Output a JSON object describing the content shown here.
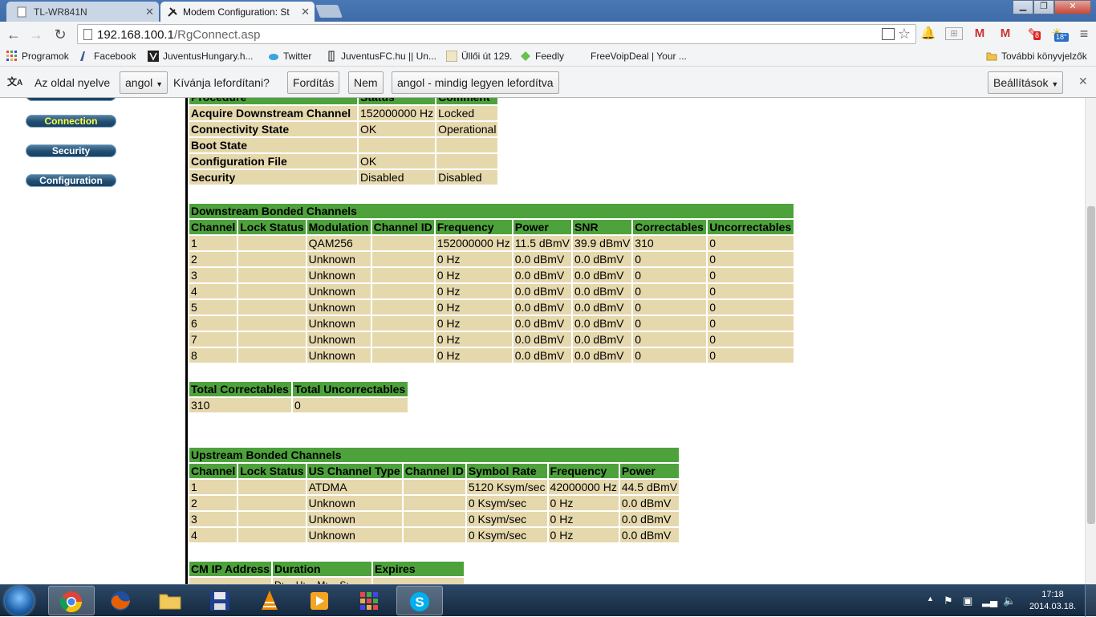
{
  "tabs": [
    {
      "title": "TL-WR841N",
      "active": false
    },
    {
      "title": "Modem Configuration: St",
      "active": true
    }
  ],
  "omnibox": {
    "host": "192.168.100.1",
    "path": "/RgConnect.asp"
  },
  "bookmarks": [
    {
      "label": "Programok",
      "icon": "apps-grid-icon"
    },
    {
      "label": "Facebook",
      "icon": "facebook-icon"
    },
    {
      "label": "JuventusHungary.h...",
      "icon": "juventus-hungary-icon"
    },
    {
      "label": "Twitter",
      "icon": "twitter-bird-icon"
    },
    {
      "label": "JuventusFC.hu || Un...",
      "icon": "juventus-crest-icon"
    },
    {
      "label": "Üllői út 129.",
      "icon": "ulloi-icon"
    },
    {
      "label": "Feedly",
      "icon": "feedly-icon"
    },
    {
      "label": "FreeVoipDeal | Your ...",
      "icon": ""
    },
    {
      "label": "További könyvjelzők",
      "icon": "folder-icon"
    }
  ],
  "translate": {
    "prompt_1": "Az oldal nyelve",
    "language": "angol",
    "prompt_2": "Kívánja lefordítani?",
    "translate_btn": "Fordítás",
    "no_btn": "Nem",
    "always_btn": "angol - mindig legyen lefordítva",
    "settings_btn": "Beállítások"
  },
  "sidebar": {
    "items": [
      {
        "label": "Connection",
        "active": true
      },
      {
        "label": "Security",
        "active": false
      },
      {
        "label": "Configuration",
        "active": false
      }
    ]
  },
  "startup": {
    "headers": [
      "Procedure",
      "Status",
      "Comment"
    ],
    "rows": [
      [
        "Acquire Downstream Channel",
        "152000000 Hz",
        "Locked"
      ],
      [
        "Connectivity State",
        "OK",
        "Operational"
      ],
      [
        "Boot State",
        "",
        ""
      ],
      [
        "Configuration File",
        "OK",
        ""
      ],
      [
        "Security",
        "Disabled",
        "Disabled"
      ]
    ]
  },
  "downstream": {
    "title": "Downstream Bonded Channels",
    "headers": [
      "Channel",
      "Lock Status",
      "Modulation",
      "Channel ID",
      "Frequency",
      "Power",
      "SNR",
      "Correctables",
      "Uncorrectables"
    ],
    "rows": [
      [
        "1",
        "",
        "QAM256",
        "",
        "152000000 Hz",
        "11.5 dBmV",
        "39.9 dBmV",
        "310",
        "0"
      ],
      [
        "2",
        "",
        "Unknown",
        "",
        "0 Hz",
        "0.0 dBmV",
        "0.0 dBmV",
        "0",
        "0"
      ],
      [
        "3",
        "",
        "Unknown",
        "",
        "0 Hz",
        "0.0 dBmV",
        "0.0 dBmV",
        "0",
        "0"
      ],
      [
        "4",
        "",
        "Unknown",
        "",
        "0 Hz",
        "0.0 dBmV",
        "0.0 dBmV",
        "0",
        "0"
      ],
      [
        "5",
        "",
        "Unknown",
        "",
        "0 Hz",
        "0.0 dBmV",
        "0.0 dBmV",
        "0",
        "0"
      ],
      [
        "6",
        "",
        "Unknown",
        "",
        "0 Hz",
        "0.0 dBmV",
        "0.0 dBmV",
        "0",
        "0"
      ],
      [
        "7",
        "",
        "Unknown",
        "",
        "0 Hz",
        "0.0 dBmV",
        "0.0 dBmV",
        "0",
        "0"
      ],
      [
        "8",
        "",
        "Unknown",
        "",
        "0 Hz",
        "0.0 dBmV",
        "0.0 dBmV",
        "0",
        "0"
      ]
    ]
  },
  "totals": {
    "headers": [
      "Total Correctables",
      "Total Uncorrectables"
    ],
    "values": [
      "310",
      "0"
    ]
  },
  "upstream": {
    "title": "Upstream Bonded Channels",
    "headers": [
      "Channel",
      "Lock Status",
      "US Channel Type",
      "Channel ID",
      "Symbol Rate",
      "Frequency",
      "Power"
    ],
    "rows": [
      [
        "1",
        "",
        "ATDMA",
        "",
        "5120 Ksym/sec",
        "42000000 Hz",
        "44.5 dBmV"
      ],
      [
        "2",
        "",
        "Unknown",
        "",
        "0 Ksym/sec",
        "0 Hz",
        "0.0 dBmV"
      ],
      [
        "3",
        "",
        "Unknown",
        "",
        "0 Ksym/sec",
        "0 Hz",
        "0.0 dBmV"
      ],
      [
        "4",
        "",
        "Unknown",
        "",
        "0 Ksym/sec",
        "0 Hz",
        "0.0 dBmV"
      ]
    ]
  },
  "cmip": {
    "headers": [
      "CM IP Address",
      "Duration",
      "Expires"
    ],
    "row_partial": [
      "",
      "D: -- H: -- M: -- S: --",
      ""
    ]
  },
  "taskbar": {
    "apps": [
      "chrome-icon",
      "firefox-icon",
      "explorer-folder-icon",
      "save-disk-icon",
      "vlc-icon",
      "media-player-icon",
      "apps-grid-icon",
      "skype-icon"
    ],
    "time": "17:18",
    "date": "2014.03.18."
  },
  "weather_badge": "18°",
  "notif_badge": "8",
  "colors": {
    "header_green": "#4ea23c",
    "cell_tan": "#e6d8ad",
    "nav_blue": "#1f4e72"
  }
}
